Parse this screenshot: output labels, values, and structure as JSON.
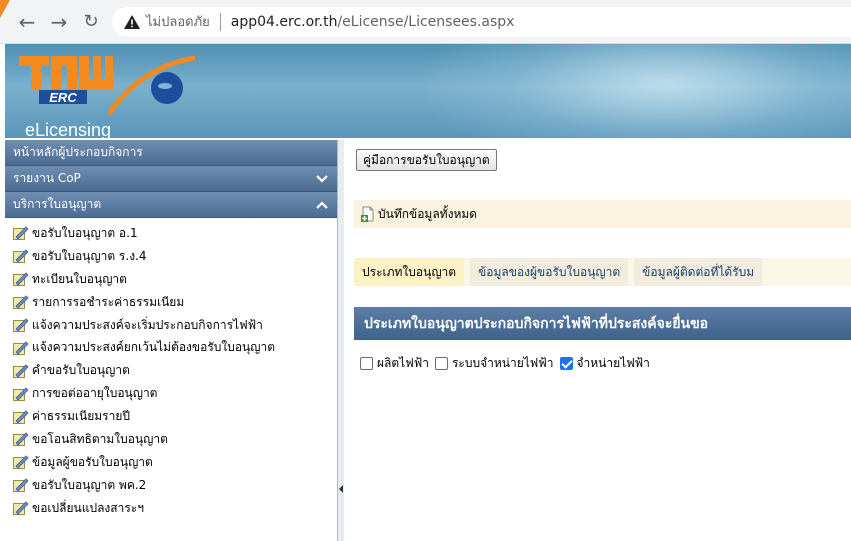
{
  "browser": {
    "security_label": "ไม่ปลอดภัย",
    "url_host": "app04.erc.or.th",
    "url_path": "/eLicense/Licensees.aspx"
  },
  "banner": {
    "logo_text": "ERC",
    "brand": "eLicensing"
  },
  "sidebar": {
    "headers": [
      {
        "label": "หน้าหลักผู้ประกอบกิจการ"
      },
      {
        "label": "รายงาน CoP",
        "chevron": "chevron-down-icon"
      },
      {
        "label": "บริการใบอนุญาต",
        "chevron": "chevron-up-icon"
      }
    ],
    "items": [
      {
        "label": "ขอรับใบอนุญาต อ.1",
        "icon": "edit-document-icon"
      },
      {
        "label": "ขอรับใบอนุญาต ร.ง.4",
        "icon": "edit-document-icon"
      },
      {
        "label": "ทะเบียนใบอนุญาต",
        "icon": "edit-document-icon"
      },
      {
        "label": "รายการรอชำระค่าธรรมเนียม",
        "icon": "edit-document-icon"
      },
      {
        "label": "แจ้งความประสงค์จะเริ่มประกอบกิจการไฟฟ้า",
        "icon": "edit-document-icon"
      },
      {
        "label": "แจ้งความประสงค์ยกเว้นไม่ต้องขอรับใบอนุญาต",
        "icon": "edit-document-icon"
      },
      {
        "label": "คำขอรับใบอนุญาต",
        "icon": "edit-document-icon"
      },
      {
        "label": "การขอต่ออายุใบอนุญาต",
        "icon": "edit-document-icon"
      },
      {
        "label": "ค่าธรรมเนียมรายปี",
        "icon": "edit-document-icon"
      },
      {
        "label": "ขอโอนสิทธิตามใบอนุญาต",
        "icon": "edit-document-icon"
      },
      {
        "label": "ข้อมูลผู้ขอรับใบอนุญาต",
        "icon": "edit-document-icon"
      },
      {
        "label": "ขอรับใบอนุญาต พค.2",
        "icon": "edit-document-icon"
      },
      {
        "label": "ขอเปลี่ยนแปลงสาระฯ",
        "icon": "edit-document-icon"
      }
    ]
  },
  "main": {
    "guide_button": "คู่มือการขอรับใบอนุญาต",
    "save_all": "บันทึกข้อมูลทั้งหมด",
    "tabs": [
      {
        "label": "ประเภทใบอนุญาต",
        "active": true
      },
      {
        "label": "ข้อมูลของผู้ขอรับใบอนุญาต",
        "active": false
      },
      {
        "label": "ข้อมูลผู้ติดต่อที่ได้รับม",
        "active": false
      }
    ],
    "section_title": "ประเภทใบอนุญาตประกอบกิจการไฟฟ้าที่ประสงค์จะยื่นขอ",
    "options": [
      {
        "label": "ผลิตไฟฟ้า",
        "checked": false
      },
      {
        "label": "ระบบจำหน่ายไฟฟ้า",
        "checked": false
      },
      {
        "label": "จำหน่ายไฟฟ้า",
        "checked": true
      }
    ]
  },
  "colors": {
    "sidebar_header": "#4d6c93",
    "section_header": "#3f628c",
    "checkbox_on": "#1a73e8",
    "banner": "#5a95b9"
  }
}
